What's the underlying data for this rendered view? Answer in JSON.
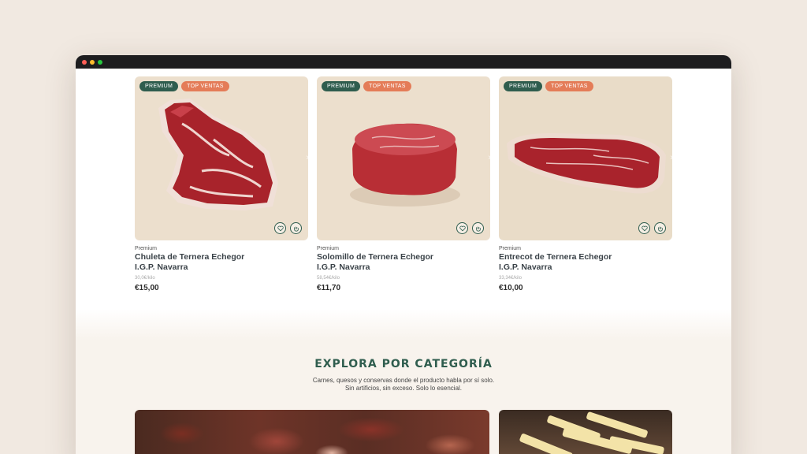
{
  "products": [
    {
      "badges": [
        "PREMIUM",
        "TOP VENTAS"
      ],
      "category": "Premium",
      "name_line1": "Chuleta de Ternera Echegor",
      "name_line2": "I.G.P. Navarra",
      "price_per_kg": "30,0€/kilo",
      "price": "€15,00",
      "image": "bone-in-ribeye"
    },
    {
      "badges": [
        "PREMIUM",
        "TOP VENTAS"
      ],
      "category": "Premium",
      "name_line1": "Solomillo de Ternera Echegor",
      "name_line2": "I.G.P. Navarra",
      "price_per_kg": "58,54€/kilo",
      "price": "€11,70",
      "image": "tenderloin"
    },
    {
      "badges": [
        "PREMIUM",
        "TOP VENTAS"
      ],
      "category": "Premium",
      "name_line1": "Entrecot de Ternera Echegor",
      "name_line2": "I.G.P. Navarra",
      "price_per_kg": "33,34€/kilo",
      "price": "€10,00",
      "image": "strip-steak"
    }
  ],
  "explore": {
    "title": "EXPLORA POR CATEGORÍA",
    "subtitle_line1": "Carnes, quesos y conservas donde el producto habla por sí solo.",
    "subtitle_line2": "Sin artificios, sin exceso. Solo lo esencial."
  },
  "icons": {
    "wishlist": "heart-icon",
    "quick_view": "hand-icon",
    "next": "chevron-right-icon"
  },
  "colors": {
    "brand_green": "#2f5d4e",
    "badge_orange": "#e47c58",
    "photo_bg": "#ecdfcd"
  }
}
